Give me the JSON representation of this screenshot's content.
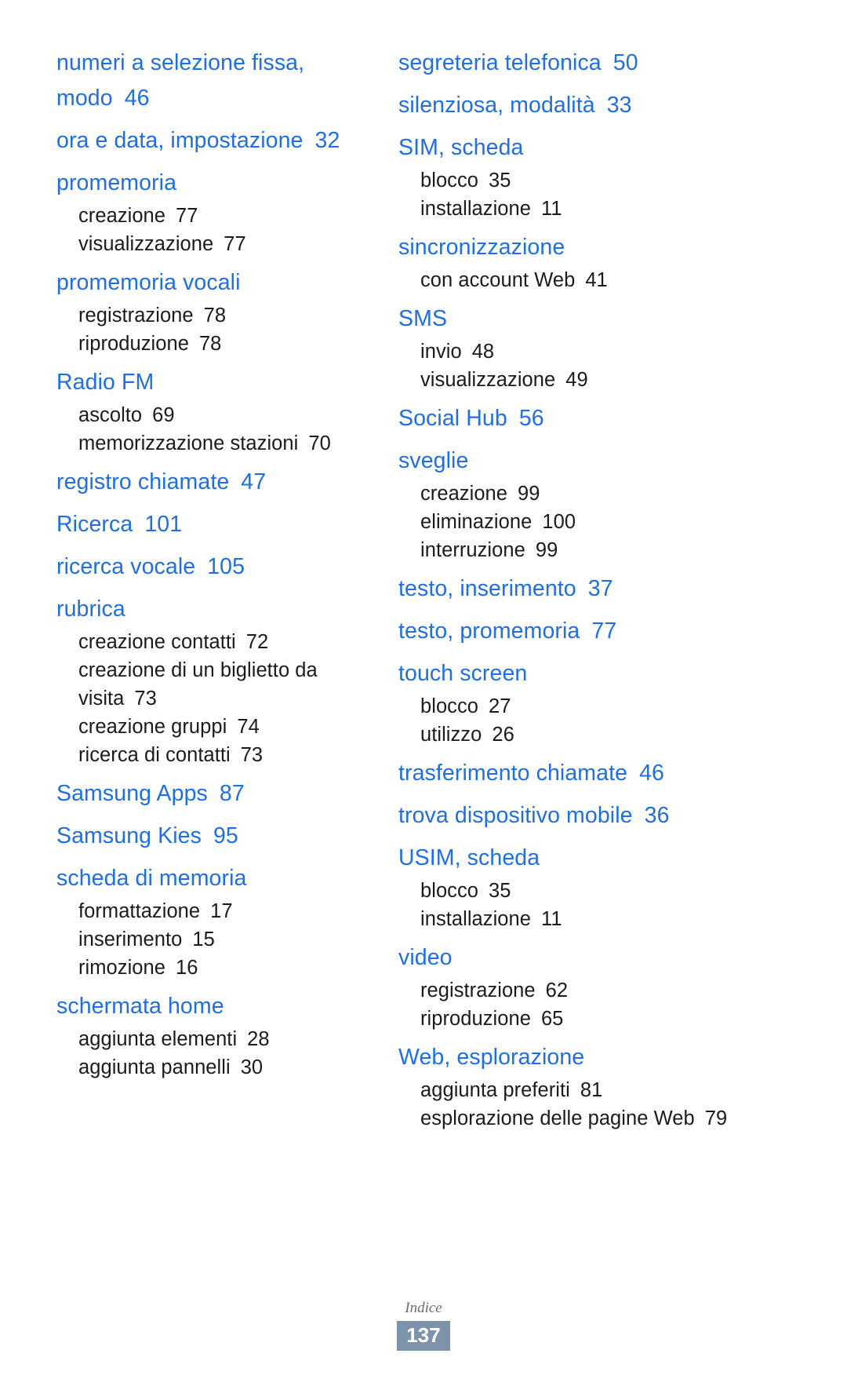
{
  "document": {
    "type": "index-page",
    "language": "it",
    "accent_color": "#1f6fe0",
    "text_color": "#1b1b1b"
  },
  "footer": {
    "label": "Indice",
    "page_number": "137"
  },
  "columns": [
    {
      "id": "left",
      "groups": [
        {
          "main": {
            "label": "numeri a selezione fissa, modo",
            "page": "46"
          },
          "subs": []
        },
        {
          "main": {
            "label": "ora e data, impostazione",
            "page": "32"
          },
          "subs": []
        },
        {
          "main": {
            "label": "promemoria",
            "page": ""
          },
          "subs": [
            {
              "label": "creazione",
              "page": "77"
            },
            {
              "label": "visualizzazione",
              "page": "77"
            }
          ]
        },
        {
          "main": {
            "label": "promemoria vocali",
            "page": ""
          },
          "subs": [
            {
              "label": "registrazione",
              "page": "78"
            },
            {
              "label": "riproduzione",
              "page": "78"
            }
          ]
        },
        {
          "main": {
            "label": "Radio FM",
            "page": ""
          },
          "subs": [
            {
              "label": "ascolto",
              "page": "69"
            },
            {
              "label": "memorizzazione stazioni",
              "page": "70"
            }
          ]
        },
        {
          "main": {
            "label": "registro chiamate",
            "page": "47"
          },
          "subs": []
        },
        {
          "main": {
            "label": "Ricerca",
            "page": "101"
          },
          "subs": []
        },
        {
          "main": {
            "label": "ricerca vocale",
            "page": "105"
          },
          "subs": []
        },
        {
          "main": {
            "label": "rubrica",
            "page": ""
          },
          "subs": [
            {
              "label": "creazione contatti",
              "page": "72"
            },
            {
              "label": "creazione di un biglietto da visita",
              "page": "73"
            },
            {
              "label": "creazione gruppi",
              "page": "74"
            },
            {
              "label": "ricerca di contatti",
              "page": "73"
            }
          ]
        },
        {
          "main": {
            "label": "Samsung Apps",
            "page": "87"
          },
          "subs": []
        },
        {
          "main": {
            "label": "Samsung Kies",
            "page": "95"
          },
          "subs": []
        },
        {
          "main": {
            "label": "scheda di memoria",
            "page": ""
          },
          "subs": [
            {
              "label": "formattazione",
              "page": "17"
            },
            {
              "label": "inserimento",
              "page": "15"
            },
            {
              "label": "rimozione",
              "page": "16"
            }
          ]
        },
        {
          "main": {
            "label": "schermata home",
            "page": ""
          },
          "subs": [
            {
              "label": "aggiunta elementi",
              "page": "28"
            },
            {
              "label": "aggiunta pannelli",
              "page": "30"
            }
          ]
        }
      ]
    },
    {
      "id": "right",
      "groups": [
        {
          "main": {
            "label": "segreteria telefonica",
            "page": "50"
          },
          "subs": []
        },
        {
          "main": {
            "label": "silenziosa, modalità",
            "page": "33"
          },
          "subs": []
        },
        {
          "main": {
            "label": "SIM, scheda",
            "page": ""
          },
          "subs": [
            {
              "label": "blocco",
              "page": "35"
            },
            {
              "label": "installazione",
              "page": "11"
            }
          ]
        },
        {
          "main": {
            "label": "sincronizzazione",
            "page": ""
          },
          "subs": [
            {
              "label": "con account Web",
              "page": "41"
            }
          ]
        },
        {
          "main": {
            "label": "SMS",
            "page": ""
          },
          "subs": [
            {
              "label": "invio",
              "page": "48"
            },
            {
              "label": "visualizzazione",
              "page": "49"
            }
          ]
        },
        {
          "main": {
            "label": "Social Hub",
            "page": "56"
          },
          "subs": []
        },
        {
          "main": {
            "label": "sveglie",
            "page": ""
          },
          "subs": [
            {
              "label": "creazione",
              "page": "99"
            },
            {
              "label": "eliminazione",
              "page": "100"
            },
            {
              "label": "interruzione",
              "page": "99"
            }
          ]
        },
        {
          "main": {
            "label": "testo, inserimento",
            "page": "37"
          },
          "subs": []
        },
        {
          "main": {
            "label": "testo, promemoria",
            "page": "77"
          },
          "subs": []
        },
        {
          "main": {
            "label": "touch screen",
            "page": ""
          },
          "subs": [
            {
              "label": "blocco",
              "page": "27"
            },
            {
              "label": "utilizzo",
              "page": "26"
            }
          ]
        },
        {
          "main": {
            "label": "trasferimento chiamate",
            "page": "46"
          },
          "subs": []
        },
        {
          "main": {
            "label": "trova dispositivo mobile",
            "page": "36"
          },
          "subs": []
        },
        {
          "main": {
            "label": "USIM, scheda",
            "page": ""
          },
          "subs": [
            {
              "label": "blocco",
              "page": "35"
            },
            {
              "label": "installazione",
              "page": "11"
            }
          ]
        },
        {
          "main": {
            "label": "video",
            "page": ""
          },
          "subs": [
            {
              "label": "registrazione",
              "page": "62"
            },
            {
              "label": "riproduzione",
              "page": "65"
            }
          ]
        },
        {
          "main": {
            "label": "Web, esplorazione",
            "page": ""
          },
          "subs": [
            {
              "label": "aggiunta preferiti",
              "page": "81"
            },
            {
              "label": "esplorazione delle pagine Web",
              "page": "79"
            }
          ]
        }
      ]
    }
  ]
}
